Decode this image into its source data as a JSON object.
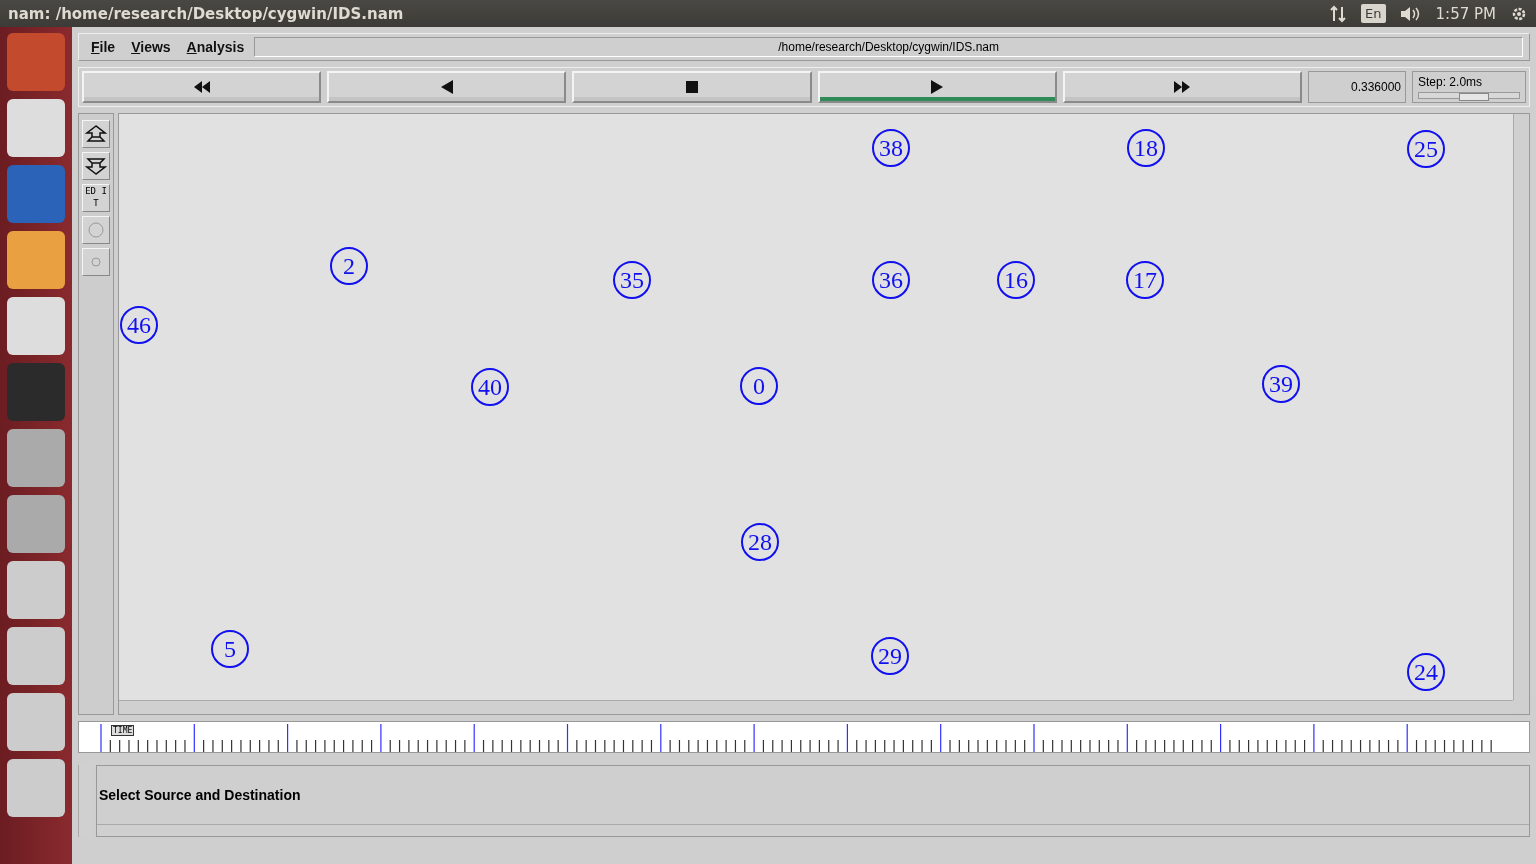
{
  "top_panel": {
    "title": "nam: /home/research/Desktop/cygwin/IDS.nam",
    "keyboard": "En",
    "clock": "1:57 PM"
  },
  "menu": [
    {
      "label": "File"
    },
    {
      "label": "Views"
    },
    {
      "label": "Analysis"
    }
  ],
  "file_path": "/home/research/Desktop/cygwin/IDS.nam",
  "transport": [
    {
      "kind": "rewind",
      "selected": false
    },
    {
      "kind": "back",
      "selected": false
    },
    {
      "kind": "stop",
      "selected": false
    },
    {
      "kind": "play",
      "selected": true
    },
    {
      "kind": "forward",
      "selected": false
    }
  ],
  "time": "0.336000",
  "step": {
    "label": "Step: 2.0ms",
    "level": 0.55
  },
  "tools": [
    {
      "kind": "zoom-in"
    },
    {
      "kind": "zoom-out"
    },
    {
      "kind": "edit",
      "label": "ED IT"
    },
    {
      "kind": "big-circle"
    },
    {
      "kind": "small-circle"
    }
  ],
  "nodes": [
    {
      "label": "38"
    },
    {
      "label": "18"
    },
    {
      "label": "25"
    },
    {
      "label": "2"
    },
    {
      "label": "35"
    },
    {
      "label": "36"
    },
    {
      "label": "16"
    },
    {
      "label": "17"
    },
    {
      "label": "46"
    },
    {
      "label": "40"
    },
    {
      "label": "0"
    },
    {
      "label": "39"
    },
    {
      "label": "28"
    },
    {
      "label": "5"
    },
    {
      "label": "29"
    },
    {
      "label": "24"
    }
  ],
  "timeline": {
    "label": "TIME",
    "level": 0.02
  },
  "status": "Select Source and Destination"
}
